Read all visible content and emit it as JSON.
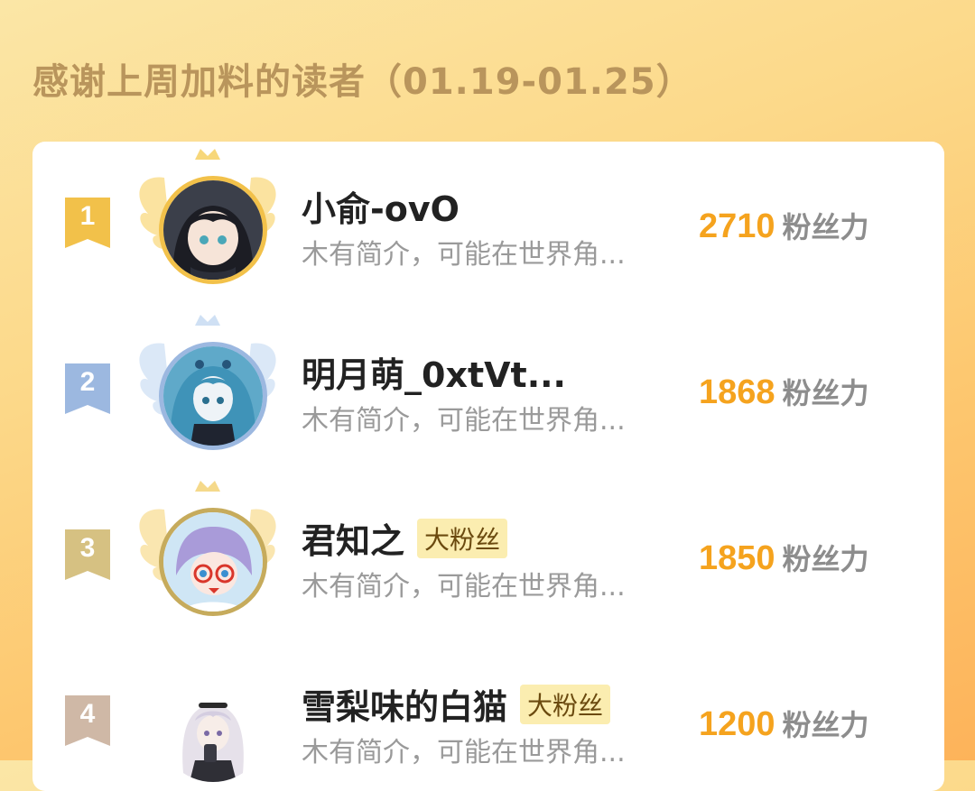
{
  "header": {
    "title": "感谢上周加料的读者（01.19-01.25）"
  },
  "colors": {
    "gold": "#f2c14a",
    "silver": "#9cb8e0",
    "bronze": "#d6c182",
    "fourth": "#cfb8a6",
    "score": "#f5a31e"
  },
  "readers": [
    {
      "rank": "1",
      "name": "小俞-ovO",
      "tag": "",
      "bio": "木有简介，可能在世界角...",
      "score": "2710",
      "unit": "粉丝力",
      "avatar_icon": "anime-girl-dark-hair-avatar"
    },
    {
      "rank": "2",
      "name": "明月萌_0xtVt...",
      "tag": "",
      "bio": "木有简介，可能在世界角...",
      "score": "1868",
      "unit": "粉丝力",
      "avatar_icon": "anime-girl-blue-hair-avatar"
    },
    {
      "rank": "3",
      "name": "君知之",
      "tag": "大粉丝",
      "bio": "木有简介，可能在世界角...",
      "score": "1850",
      "unit": "粉丝力",
      "avatar_icon": "anime-boy-glasses-avatar"
    },
    {
      "rank": "4",
      "name": "雪梨味的白猫",
      "tag": "大粉丝",
      "bio": "木有简介，可能在世界角...",
      "score": "1200",
      "unit": "粉丝力",
      "avatar_icon": "anime-girl-white-hair-avatar"
    }
  ]
}
